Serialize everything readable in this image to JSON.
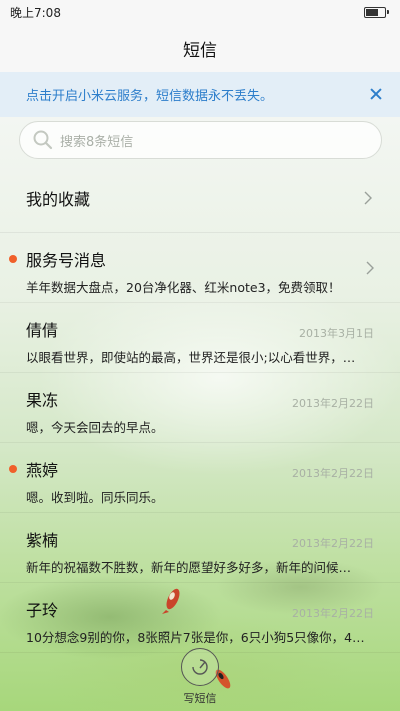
{
  "status_bar": {
    "time": "晚上7:08"
  },
  "header": {
    "title": "短信"
  },
  "banner": {
    "text": "点击开启小米云服务，短信数据永不丢失。"
  },
  "search": {
    "placeholder": "搜索8条短信"
  },
  "favorites": {
    "label": "我的收藏"
  },
  "threads": [
    {
      "name": "服务号消息",
      "preview": "羊年数据大盘点，20台净化器、红米note3，免费领取！",
      "date": "",
      "unread": true
    },
    {
      "name": "倩倩",
      "preview": "以眼看世界，即使站的最高，世界还是很小;以心看世界，…",
      "date": "2013年3月1日",
      "unread": false
    },
    {
      "name": "果冻",
      "preview": "嗯，今天会回去的早点。",
      "date": "2013年2月22日",
      "unread": false
    },
    {
      "name": "燕婷",
      "preview": "嗯。收到啦。同乐同乐。",
      "date": "2013年2月22日",
      "unread": true
    },
    {
      "name": "紫楠",
      "preview": "新年的祝福数不胜数，新年的愿望好多好多，新年的问候…",
      "date": "2013年2月22日",
      "unread": false
    },
    {
      "name": "子玲",
      "preview": "10分想念9别的你，8张照片7张是你，6只小狗5只像你，4…",
      "date": "2013年2月22日",
      "unread": false
    }
  ],
  "compose": {
    "label": "写短信"
  },
  "colors": {
    "accent": "#2d7ecb",
    "unread": "#f0602a"
  },
  "icons": [
    "battery-icon",
    "close-icon",
    "search-icon",
    "chevron-right-icon",
    "compose-icon"
  ]
}
